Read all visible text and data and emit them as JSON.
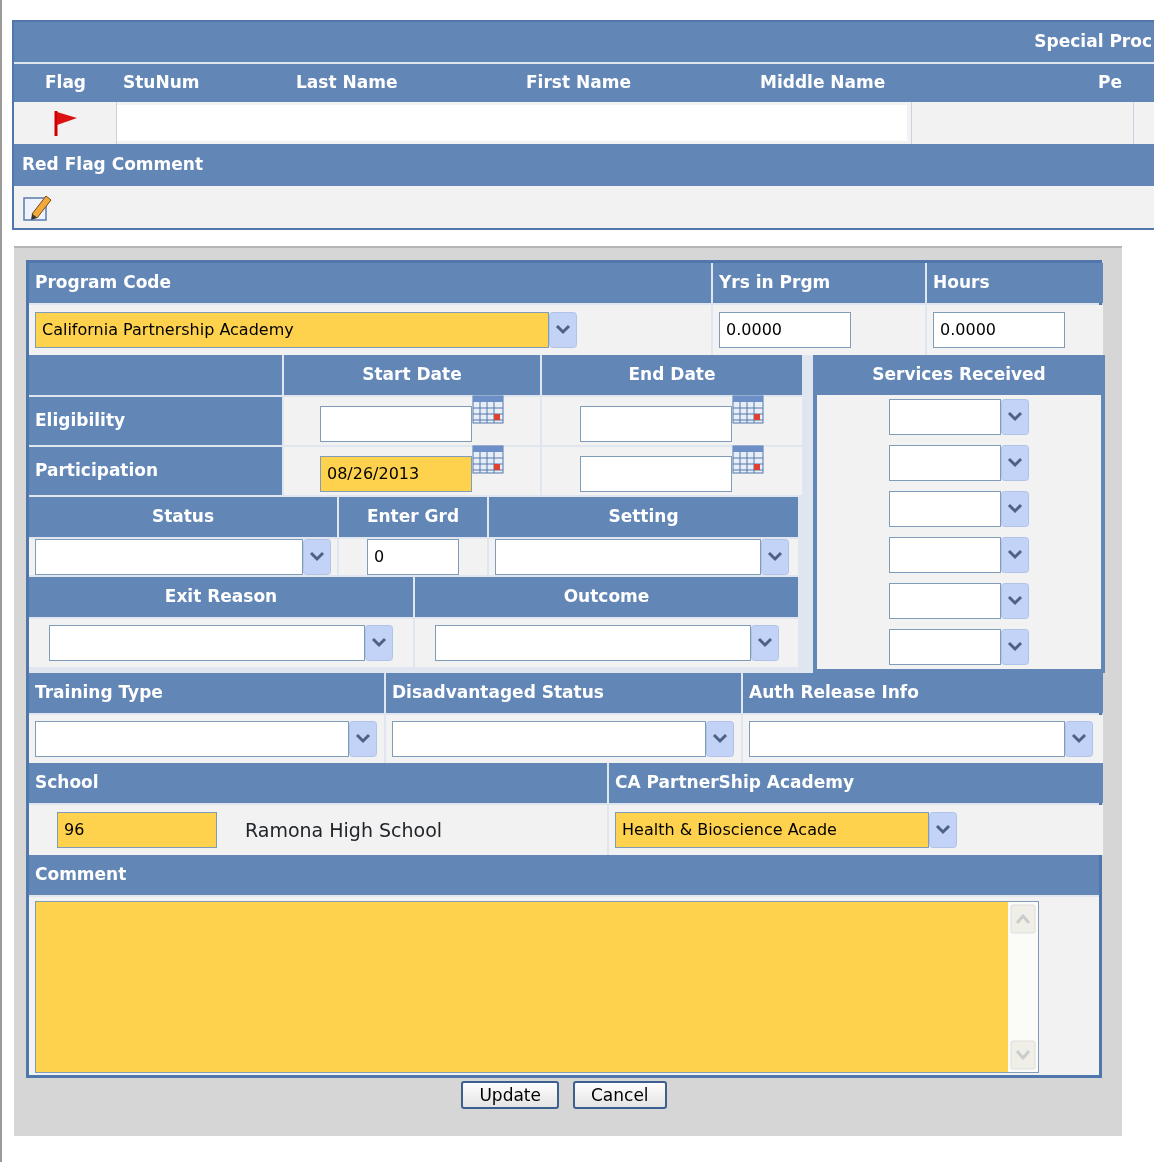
{
  "header": {
    "title": "Special Proc"
  },
  "student_table": {
    "columns": [
      "Flag",
      "StuNum",
      "Last Name",
      "First Name",
      "Middle Name",
      "Pe"
    ],
    "flagged": true
  },
  "red_flag_comment": {
    "label": "Red Flag Comment"
  },
  "program_code": {
    "label": "Program Code",
    "value": "California Partnership Academy",
    "highlighted": true
  },
  "years_in_program": {
    "label": "Yrs in Prgm",
    "value": "0.0000",
    "highlighted": false
  },
  "hours": {
    "label": "Hours",
    "value": "0.0000",
    "highlighted": false
  },
  "dates": {
    "columns": [
      "Start Date",
      "End Date"
    ],
    "rows": [
      {
        "label": "Eligibility",
        "start": {
          "highlighted": false
        },
        "end": {
          "highlighted": false
        }
      },
      {
        "label": "Participation",
        "start": {
          "value": "08/26/2013",
          "highlighted": true
        },
        "end": {
          "highlighted": false
        }
      }
    ]
  },
  "status": {
    "label": "Status",
    "highlighted": false
  },
  "enter_grade": {
    "label": "Enter Grd",
    "value": "0",
    "highlighted": false
  },
  "setting": {
    "label": "Setting",
    "highlighted": false
  },
  "services_received": {
    "label": "Services Received",
    "selects": [
      {
        "highlighted": false
      },
      {
        "highlighted": false
      },
      {
        "highlighted": false
      },
      {
        "highlighted": false
      },
      {
        "highlighted": false
      },
      {
        "highlighted": false
      }
    ]
  },
  "exit_reason": {
    "label": "Exit Reason",
    "highlighted": false
  },
  "outcome": {
    "label": "Outcome",
    "highlighted": false
  },
  "training_type": {
    "label": "Training Type",
    "highlighted": false
  },
  "disadvantaged_status": {
    "label": "Disadvantaged Status",
    "highlighted": false
  },
  "auth_release_info": {
    "label": "Auth Release Info",
    "highlighted": false
  },
  "school": {
    "label": "School",
    "code": "96",
    "code_highlighted": true,
    "name": "Ramona High School"
  },
  "ca_partnership_academy": {
    "label": "CA PartnerShip Academy",
    "value": "Health & Bioscience Acade",
    "highlighted": true
  },
  "comment": {
    "label": "Comment",
    "highlighted": true
  },
  "buttons": [
    "Update",
    "Cancel"
  ]
}
